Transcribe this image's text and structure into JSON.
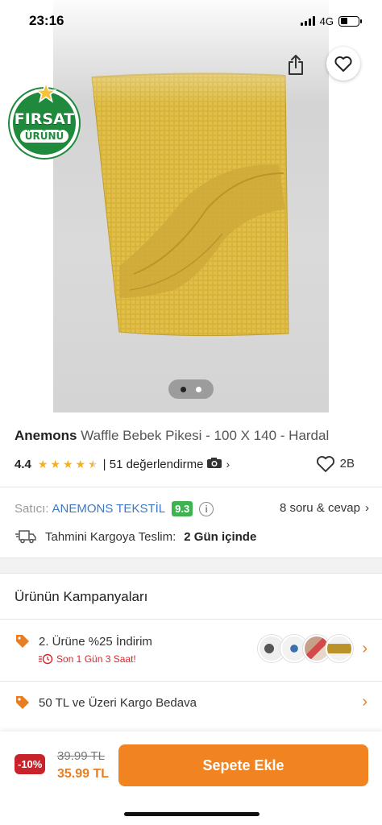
{
  "status_bar": {
    "time": "23:16",
    "network": "4G"
  },
  "header": {
    "back_icon": "arrow-left-icon",
    "share_icon": "share-icon",
    "favorite_icon": "heart-icon"
  },
  "badge": {
    "line1": "FIRSAT",
    "line2": "ÜRÜNÜ"
  },
  "gallery": {
    "image_count": 2,
    "active_index": 0
  },
  "product": {
    "brand": "Anemons",
    "name": "Waffle Bebek Pikesi - 100 X 140 - Hardal",
    "rating": "4.4",
    "rating_value": 4.4,
    "reviews": "| 51 değerlendirme",
    "likes": "2B"
  },
  "seller": {
    "label": "Satıcı:",
    "name": "ANEMONS TEKSTİL",
    "score": "9.3",
    "qa": "8 soru & cevap"
  },
  "delivery": {
    "label": "Tahmini Kargoya Teslim:",
    "value": "2 Gün içinde"
  },
  "campaigns": {
    "title": "Ürünün Kampanyaları",
    "items": [
      {
        "label": "2. Ürüne %25 İndirim",
        "timer": "Son 1 Gün 3 Saat!"
      },
      {
        "label": "50 TL ve Üzeri Kargo Bedava"
      }
    ]
  },
  "price": {
    "discount": "-10%",
    "old": "39.99 TL",
    "new": "35.99 TL",
    "cta": "Sepete Ekle"
  },
  "colors": {
    "accent": "#f28321",
    "seller_score": "#3fb34f",
    "discount": "#c8232b",
    "link": "#3d7ac3",
    "badge": "#1f8a3b",
    "product": "#d8b43a"
  }
}
